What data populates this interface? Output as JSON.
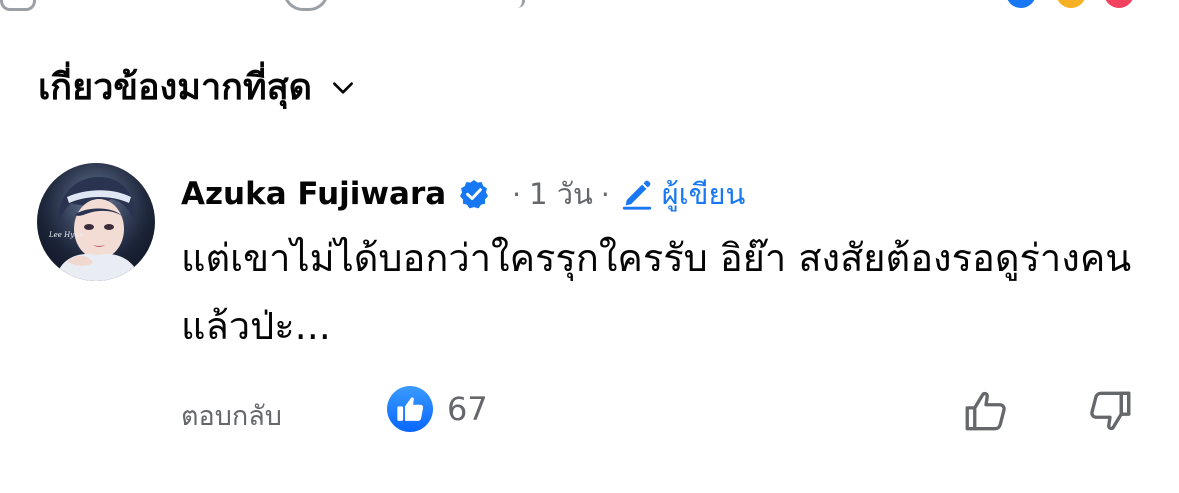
{
  "sort": {
    "label": "เกี่ยวข้องมากที่สุด"
  },
  "comment": {
    "author": "Azuka Fujiwara",
    "verified": true,
    "separator": "·",
    "time": "1 วัน",
    "author_badge": "ผู้เขียน",
    "text": "แต่เขาไม่ได้บอกว่าใครรุกใครรับ อิย๊า สงสัยต้องรอดูร่างคนแล้วป่ะ...",
    "avatar_caption": "Lee Hyun"
  },
  "actions": {
    "reply_label": "ตอบกลับ",
    "like_count": "67"
  },
  "icons": {
    "sort": "chevron-down-icon",
    "verified": "verified-badge-icon",
    "author_badge": "pencil-icon",
    "like_badge": "like-reaction-icon",
    "upvote": "thumbs-up-icon",
    "downvote": "thumbs-down-icon"
  },
  "colors": {
    "accent": "#1877f2",
    "secondary_text": "#65676b",
    "primary_text": "#050505"
  }
}
